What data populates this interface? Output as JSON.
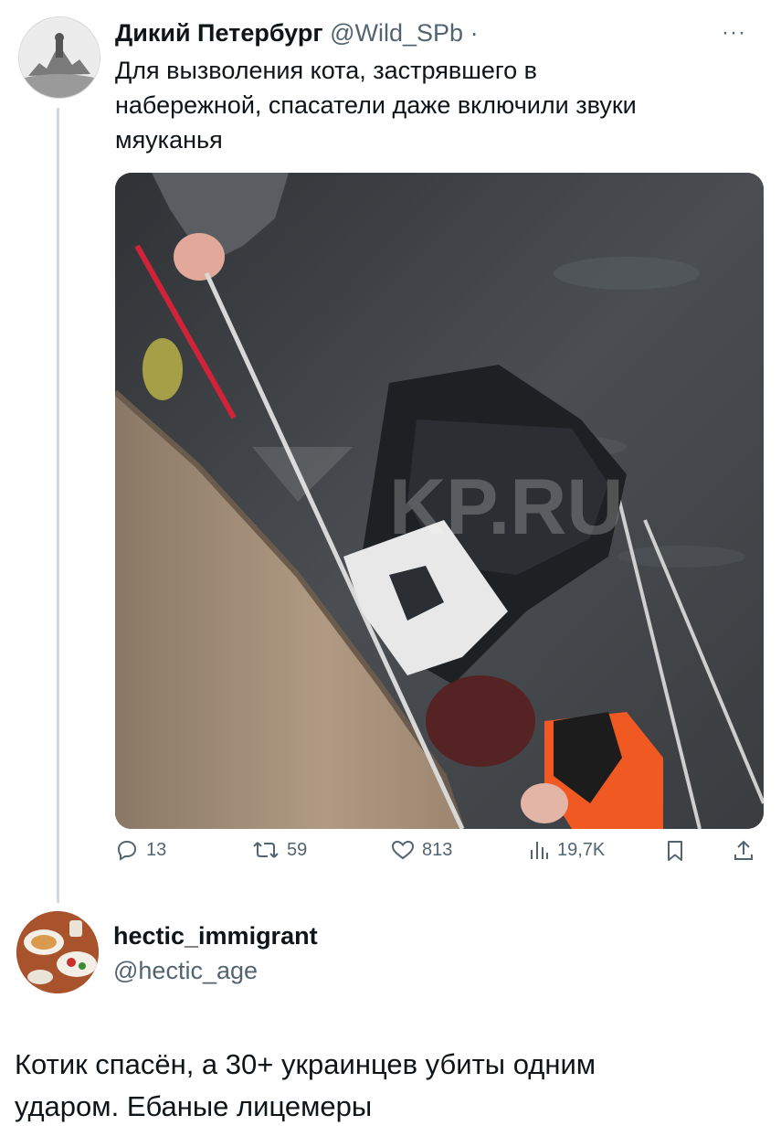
{
  "tweet": {
    "author_name": "Дикий Петербург",
    "author_handle": "@Wild_SPb",
    "separator": "·",
    "more_label": "···",
    "text": "Для вызволения кота, застрявшего в\nнабережной, спасатели даже включили звуки\nмяуканья",
    "media": {
      "watermark": "KP.RU",
      "mute_icon": "speaker-muted-icon"
    },
    "actions": {
      "replies": "13",
      "retweets": "59",
      "likes": "813",
      "views": "19,7K"
    }
  },
  "reply": {
    "author_name": "hectic_immigrant",
    "author_handle": "@hectic_age",
    "text": "Котик спасён, а 30+ украинцев убиты одним\nударом. Ебаные лицемеры"
  },
  "colors": {
    "text": "#0f1419",
    "secondary": "#536471",
    "thread_line": "#cfd9de",
    "water": "#3c4044",
    "vest": "#f05a22"
  },
  "icons": [
    "reply-icon",
    "retweet-icon",
    "like-icon",
    "views-icon",
    "bookmark-icon",
    "share-icon",
    "speaker-muted-icon"
  ]
}
